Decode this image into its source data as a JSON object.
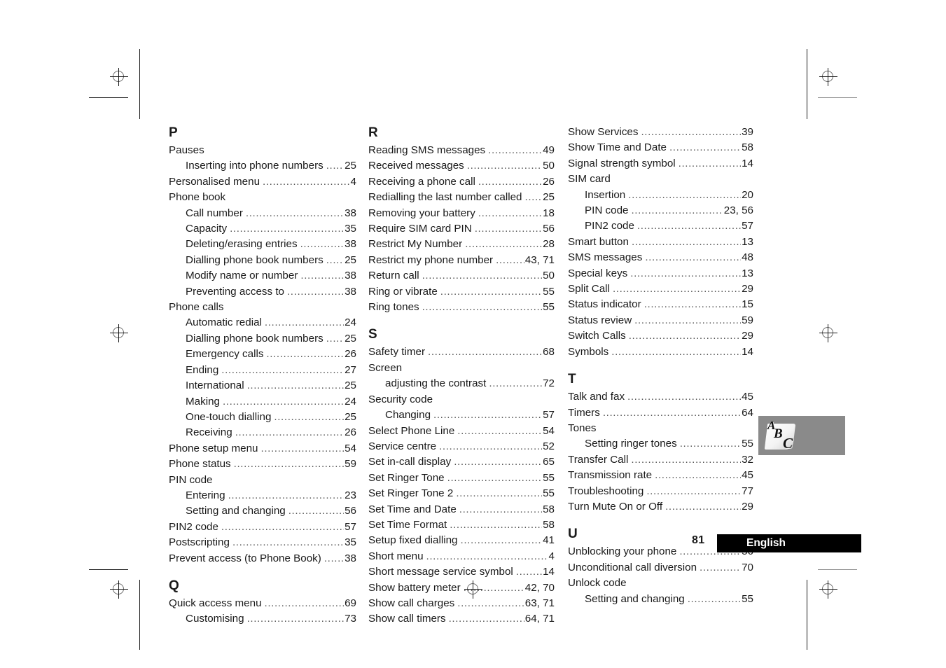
{
  "document": {
    "page_number": "81",
    "language_label": "English",
    "thumb_tab": {
      "letters": [
        "A",
        "B",
        "C"
      ],
      "background_color": "#8a8a8a"
    }
  },
  "columns": [
    {
      "id": "column-1",
      "sections": [
        {
          "letter": "P",
          "entries": [
            {
              "text": "Pauses",
              "page": "",
              "sub": false,
              "leader": false
            },
            {
              "text": "Inserting into phone numbers",
              "page": "25",
              "sub": true,
              "leader": true
            },
            {
              "text": "Personalised menu",
              "page": "4",
              "sub": false,
              "leader": true
            },
            {
              "text": "Phone book",
              "page": "",
              "sub": false,
              "leader": false
            },
            {
              "text": "Call number",
              "page": "38",
              "sub": true,
              "leader": true
            },
            {
              "text": "Capacity",
              "page": "35",
              "sub": true,
              "leader": true
            },
            {
              "text": "Deleting/erasing entries",
              "page": "38",
              "sub": true,
              "leader": true
            },
            {
              "text": "Dialling phone book numbers",
              "page": "25",
              "sub": true,
              "leader": true
            },
            {
              "text": "Modify name or number",
              "page": "38",
              "sub": true,
              "leader": true
            },
            {
              "text": "Preventing access to",
              "page": "38",
              "sub": true,
              "leader": true
            },
            {
              "text": "Phone calls",
              "page": "",
              "sub": false,
              "leader": false
            },
            {
              "text": "Automatic redial",
              "page": "24",
              "sub": true,
              "leader": true
            },
            {
              "text": "Dialling phone book numbers",
              "page": "25",
              "sub": true,
              "leader": true
            },
            {
              "text": "Emergency calls",
              "page": "26",
              "sub": true,
              "leader": true
            },
            {
              "text": "Ending",
              "page": "27",
              "sub": true,
              "leader": true
            },
            {
              "text": "International",
              "page": "25",
              "sub": true,
              "leader": true
            },
            {
              "text": "Making",
              "page": "24",
              "sub": true,
              "leader": true
            },
            {
              "text": "One-touch dialling",
              "page": "25",
              "sub": true,
              "leader": true
            },
            {
              "text": "Receiving",
              "page": "26",
              "sub": true,
              "leader": true
            },
            {
              "text": "Phone setup menu",
              "page": "54",
              "sub": false,
              "leader": true
            },
            {
              "text": "Phone status",
              "page": "59",
              "sub": false,
              "leader": true
            },
            {
              "text": "PIN code",
              "page": "",
              "sub": false,
              "leader": false
            },
            {
              "text": "Entering",
              "page": "23",
              "sub": true,
              "leader": true
            },
            {
              "text": "Setting and changing",
              "page": "56",
              "sub": true,
              "leader": true
            },
            {
              "text": "PIN2 code",
              "page": "57",
              "sub": false,
              "leader": true
            },
            {
              "text": "Postscripting",
              "page": "35",
              "sub": false,
              "leader": true
            },
            {
              "text": "Prevent access (to Phone Book)",
              "page": "38",
              "sub": false,
              "leader": true
            }
          ]
        },
        {
          "letter": "Q",
          "entries": [
            {
              "text": "Quick access menu",
              "page": "69",
              "sub": false,
              "leader": true
            },
            {
              "text": "Customising",
              "page": "73",
              "sub": true,
              "leader": true
            }
          ]
        }
      ]
    },
    {
      "id": "column-2",
      "sections": [
        {
          "letter": "R",
          "entries": [
            {
              "text": "Reading SMS messages",
              "page": "49",
              "sub": false,
              "leader": true
            },
            {
              "text": "Received messages",
              "page": "50",
              "sub": false,
              "leader": true
            },
            {
              "text": "Receiving a phone call",
              "page": "26",
              "sub": false,
              "leader": true
            },
            {
              "text": "Redialling the last number called",
              "page": "25",
              "sub": false,
              "leader": true
            },
            {
              "text": "Removing your battery",
              "page": "18",
              "sub": false,
              "leader": true
            },
            {
              "text": "Require SIM card PIN",
              "page": "56",
              "sub": false,
              "leader": true
            },
            {
              "text": "Restrict My Number",
              "page": "28",
              "sub": false,
              "leader": true
            },
            {
              "text": "Restrict my phone number",
              "page": "43, 71",
              "sub": false,
              "leader": true
            },
            {
              "text": "Return call",
              "page": "50",
              "sub": false,
              "leader": true
            },
            {
              "text": "Ring or vibrate",
              "page": "55",
              "sub": false,
              "leader": true
            },
            {
              "text": "Ring tones",
              "page": "55",
              "sub": false,
              "leader": true
            }
          ]
        },
        {
          "letter": "S",
          "entries": [
            {
              "text": "Safety timer",
              "page": "68",
              "sub": false,
              "leader": true
            },
            {
              "text": "Screen",
              "page": "",
              "sub": false,
              "leader": false
            },
            {
              "text": "adjusting the contrast",
              "page": "72",
              "sub": true,
              "leader": true
            },
            {
              "text": "Security code",
              "page": "",
              "sub": false,
              "leader": false
            },
            {
              "text": "Changing",
              "page": "57",
              "sub": true,
              "leader": true
            },
            {
              "text": "Select Phone Line",
              "page": "54",
              "sub": false,
              "leader": true
            },
            {
              "text": "Service centre",
              "page": "52",
              "sub": false,
              "leader": true
            },
            {
              "text": "Set in-call display",
              "page": "65",
              "sub": false,
              "leader": true
            },
            {
              "text": "Set Ringer Tone",
              "page": "55",
              "sub": false,
              "leader": true
            },
            {
              "text": "Set Ringer Tone 2",
              "page": "55",
              "sub": false,
              "leader": true
            },
            {
              "text": "Set Time and Date",
              "page": "58",
              "sub": false,
              "leader": true
            },
            {
              "text": "Set Time Format",
              "page": "58",
              "sub": false,
              "leader": true
            },
            {
              "text": "Setup fixed dialling",
              "page": "41",
              "sub": false,
              "leader": true
            },
            {
              "text": "Short menu",
              "page": "4",
              "sub": false,
              "leader": true
            },
            {
              "text": "Short message service symbol",
              "page": "14",
              "sub": false,
              "leader": true
            },
            {
              "text": "Show battery meter",
              "page": "42, 70",
              "sub": false,
              "leader": true
            },
            {
              "text": "Show call charges",
              "page": "63, 71",
              "sub": false,
              "leader": true
            },
            {
              "text": "Show call timers",
              "page": "64, 71",
              "sub": false,
              "leader": true
            }
          ]
        }
      ]
    },
    {
      "id": "column-3",
      "sections": [
        {
          "letter": "",
          "entries": [
            {
              "text": "Show Services",
              "page": "39",
              "sub": false,
              "leader": true
            },
            {
              "text": "Show Time and Date",
              "page": "58",
              "sub": false,
              "leader": true
            },
            {
              "text": "Signal strength symbol",
              "page": "14",
              "sub": false,
              "leader": true
            },
            {
              "text": "SIM card",
              "page": "",
              "sub": false,
              "leader": false
            },
            {
              "text": "Insertion",
              "page": "20",
              "sub": true,
              "leader": true
            },
            {
              "text": "PIN code",
              "page": "23, 56",
              "sub": true,
              "leader": true
            },
            {
              "text": "PIN2 code",
              "page": "57",
              "sub": true,
              "leader": true
            },
            {
              "text": "Smart button",
              "page": "13",
              "sub": false,
              "leader": true
            },
            {
              "text": "SMS messages",
              "page": "48",
              "sub": false,
              "leader": true
            },
            {
              "text": "Special keys",
              "page": "13",
              "sub": false,
              "leader": true
            },
            {
              "text": "Split Call",
              "page": "29",
              "sub": false,
              "leader": true
            },
            {
              "text": "Status indicator",
              "page": "15",
              "sub": false,
              "leader": true
            },
            {
              "text": "Status review",
              "page": "59",
              "sub": false,
              "leader": true
            },
            {
              "text": "Switch Calls",
              "page": "29",
              "sub": false,
              "leader": true
            },
            {
              "text": "Symbols",
              "page": "14",
              "sub": false,
              "leader": true
            }
          ]
        },
        {
          "letter": "T",
          "entries": [
            {
              "text": "Talk and fax",
              "page": "45",
              "sub": false,
              "leader": true
            },
            {
              "text": "Timers",
              "page": "64",
              "sub": false,
              "leader": true
            },
            {
              "text": "Tones",
              "page": "",
              "sub": false,
              "leader": false
            },
            {
              "text": "Setting ringer tones",
              "page": "55",
              "sub": true,
              "leader": true
            },
            {
              "text": "Transfer Call",
              "page": "32",
              "sub": false,
              "leader": true
            },
            {
              "text": "Transmission rate",
              "page": "45",
              "sub": false,
              "leader": true
            },
            {
              "text": "Troubleshooting",
              "page": "77",
              "sub": false,
              "leader": true
            },
            {
              "text": "Turn Mute On or Off",
              "page": "29",
              "sub": false,
              "leader": true
            }
          ]
        },
        {
          "letter": "U",
          "entries": [
            {
              "text": "Unblocking your phone",
              "page": "56",
              "sub": false,
              "leader": true
            },
            {
              "text": "Unconditional call diversion",
              "page": "70",
              "sub": false,
              "leader": true
            },
            {
              "text": "Unlock code",
              "page": "",
              "sub": false,
              "leader": false
            },
            {
              "text": "Setting and changing",
              "page": "55",
              "sub": true,
              "leader": true
            }
          ]
        }
      ]
    }
  ]
}
